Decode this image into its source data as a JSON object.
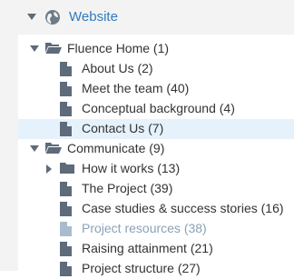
{
  "header": {
    "root_label": "Website",
    "root_icon": "globe-icon"
  },
  "tree": {
    "fluence_home": {
      "label": "Fluence Home (1)",
      "children": [
        {
          "label": "About Us (2)"
        },
        {
          "label": "Meet the team (40)"
        },
        {
          "label": "Conceptual background (4)"
        },
        {
          "label": "Contact Us (7)",
          "selected": true
        }
      ]
    },
    "communicate": {
      "label": "Communicate (9)",
      "children": [
        {
          "label": "How it works (13)",
          "type": "folder"
        },
        {
          "label": "The Project (39)"
        },
        {
          "label": "Case studies & success stories (16)"
        },
        {
          "label": "Project resources (38)",
          "muted": true
        },
        {
          "label": "Raising attainment (21)"
        },
        {
          "label": "Project structure (27)"
        }
      ]
    }
  },
  "colors": {
    "accent": "#2f7bbf",
    "icon": "#5d6b7a",
    "muted_icon": "#a9bccf",
    "selected_bg": "#e6f2fb",
    "panel_bg": "#f3f3f3"
  }
}
